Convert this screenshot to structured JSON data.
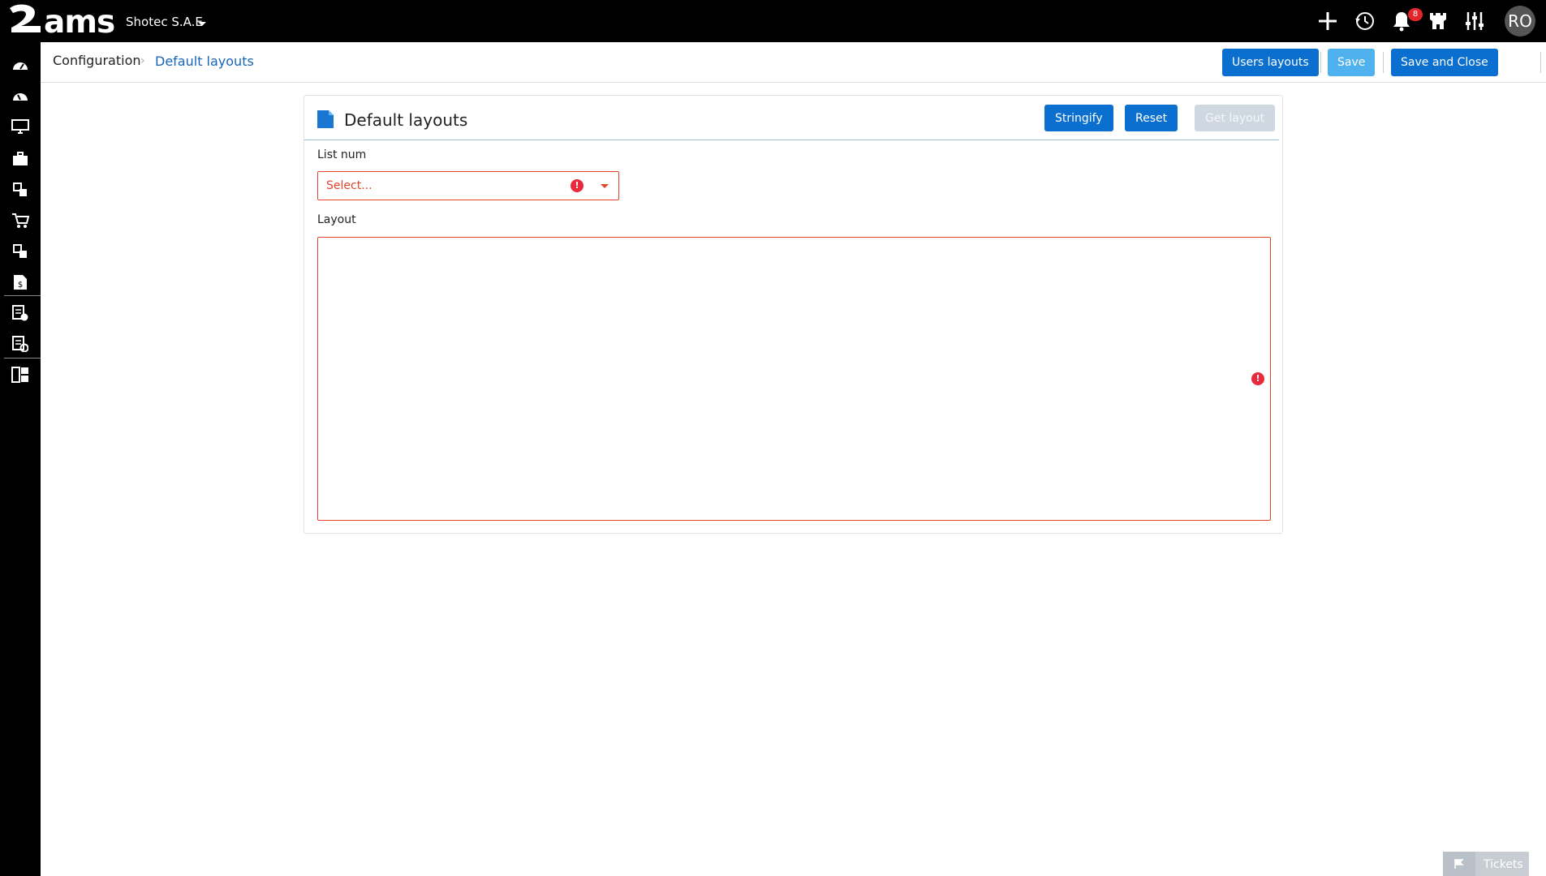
{
  "app": {
    "logo": "ams",
    "company": "Shotec S.A.E",
    "notifications_count": "8",
    "user_initials": "RO"
  },
  "breadcrumb": {
    "root": "Configuration",
    "current": "Default layouts"
  },
  "header_buttons": {
    "users_layouts": "Users layouts",
    "save": "Save",
    "save_and_close": "Save and Close"
  },
  "card": {
    "title": "Default layouts",
    "stringify": "Stringify",
    "reset": "Reset",
    "get_layout": "Get layout",
    "list_num_label": "List num",
    "list_num_placeholder": "Select...",
    "layout_label": "Layout",
    "layout_value": ""
  },
  "tickets": {
    "label": "Tickets"
  },
  "colors": {
    "primary": "#0a6fcf",
    "disabled": "#cfd8e0",
    "light": "#4fb1ee",
    "error": "#e2452b",
    "link": "#1565b8"
  }
}
